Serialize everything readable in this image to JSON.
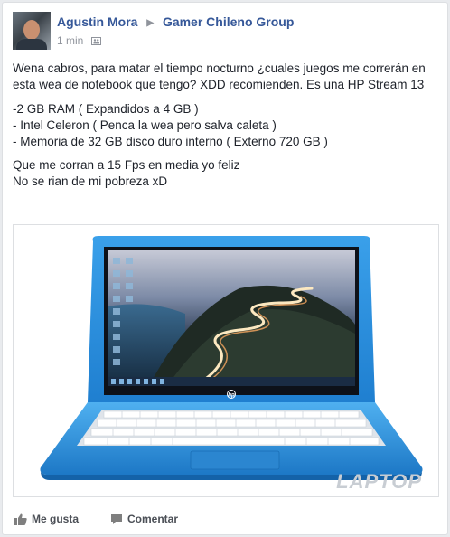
{
  "post": {
    "author": "Agustin Mora",
    "group": "Gamer Chileno Group",
    "timestamp": "1 min",
    "audience_icon": "group-icon",
    "paragraphs": [
      "Wena cabros, para matar el tiempo nocturno ¿cuales juegos me correrán en esta wea de notebook que tengo? XDD recomienden. Es una HP Stream 13"
    ],
    "specs": [
      "-2 GB RAM ( Expandidos a 4 GB )",
      "- Intel Celeron ( Penca la wea pero salva caleta )",
      "- Memoria de 32 GB disco duro interno ( Externo 720 GB )"
    ],
    "closing": [
      "Que me corran a 15 Fps en media yo feliz",
      "No se rian de mi pobreza xD"
    ],
    "photo": {
      "brand_logo": "hp",
      "watermark": "LAPTOP",
      "laptop_color": "#2a8fdc"
    }
  },
  "actions": {
    "like_label": "Me gusta",
    "comment_label": "Comentar"
  }
}
